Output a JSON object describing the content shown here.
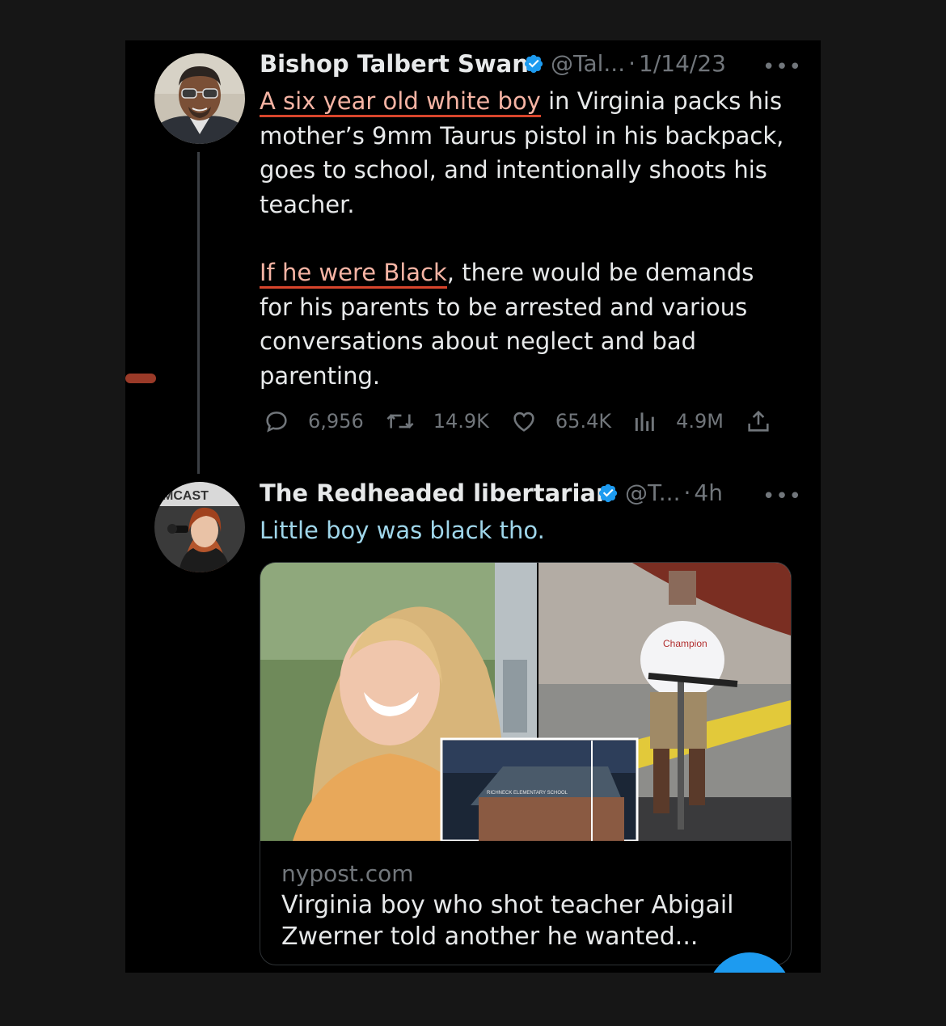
{
  "tweet1": {
    "name": "Bishop Talbert Swan",
    "handle": "@Tal...",
    "separator": "·",
    "date": "1/14/23",
    "more": "•••",
    "text_segments": [
      {
        "text": "A six year old white boy",
        "style": "highlight-red"
      },
      {
        "text": " in Virginia packs his mother’s 9mm Taurus pistol in his backpack, goes to school, and intentionally shoots his teacher.",
        "style": "plain"
      }
    ],
    "text2_segments": [
      {
        "text": "If he were Black",
        "style": "highlight-red"
      },
      {
        "text": ", there would be demands for his parents to be arrested and various conversations about neglect and bad parenting.",
        "style": "plain"
      }
    ],
    "replies": "6,956",
    "retweets": "14.9K",
    "likes": "65.4K",
    "views": "4.9M"
  },
  "tweet2": {
    "name": "The Redheaded libertarian",
    "handle": "@T...",
    "separator": "·",
    "date": "4h",
    "more": "•••",
    "text": "Little boy was black tho.",
    "avatar_banner": "MCAST",
    "card": {
      "domain": "nypost.com",
      "title": "Virginia boy who shot teacher Abigail Zwerner told another he wanted...",
      "scooter_shirt_logo": "Champion",
      "school_sign": "RICHNECK ELEMENTARY SCHOOL"
    }
  },
  "colors": {
    "background": "#161616",
    "panel": "#000000",
    "verified": "#1d9bf0",
    "highlight_red": "#c45436",
    "highlight_blue": "#528ca5",
    "muted": "#71767b"
  },
  "icons": [
    "verified-badge-icon",
    "reply-icon",
    "retweet-icon",
    "like-icon",
    "views-icon",
    "share-icon"
  ]
}
